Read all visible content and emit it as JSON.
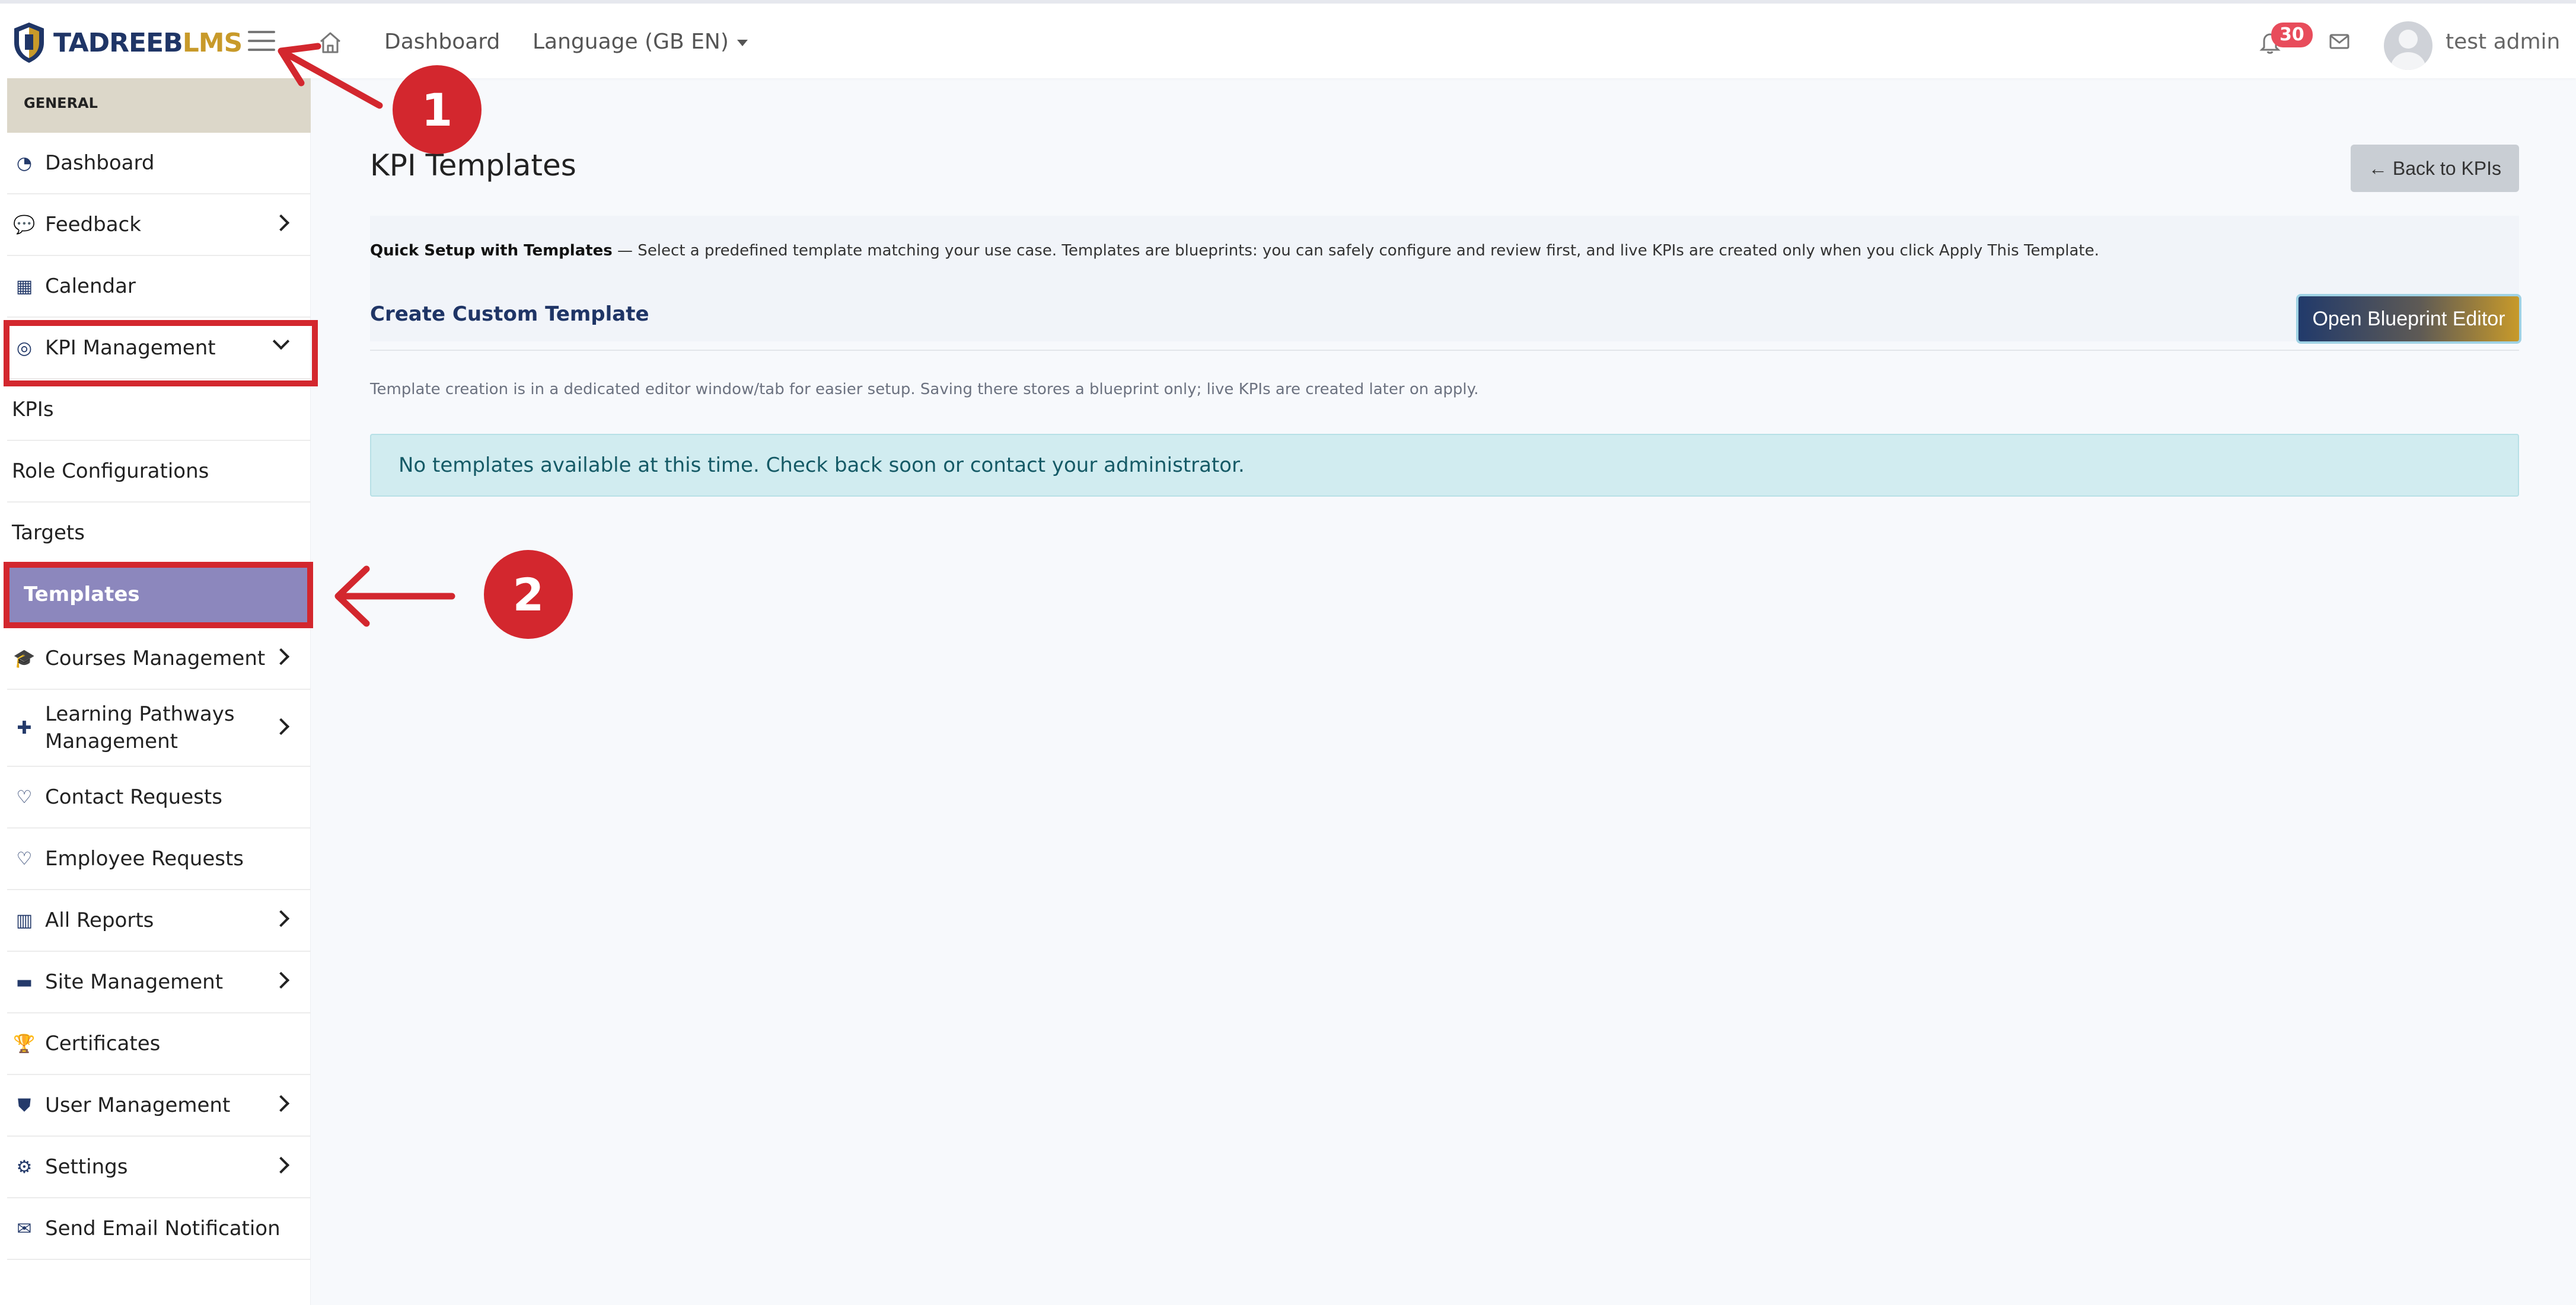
{
  "header": {
    "logo_text_a": "TADREEB",
    "logo_text_b": "LMS",
    "nav_dashboard": "Dashboard",
    "nav_language": "Language (GB EN)",
    "notification_count": "30",
    "username": "test admin"
  },
  "sidebar": {
    "section_label": "GENERAL",
    "items": {
      "dashboard": "Dashboard",
      "feedback": "Feedback",
      "calendar": "Calendar",
      "kpi_management": "KPI Management",
      "kpis": "KPIs",
      "role_configurations": "Role Configurations",
      "targets": "Targets",
      "templates": "Templates",
      "courses_management": "Courses Management",
      "learning_pathways_line1": "Learning Pathways",
      "learning_pathways_line2": "Management",
      "contact_requests": "Contact Requests",
      "employee_requests": "Employee Requests",
      "all_reports": "All Reports",
      "site_management": "Site Management",
      "certificates": "Certificates",
      "user_management": "User Management",
      "settings": "Settings",
      "send_email_notification": "Send Email Notification"
    }
  },
  "main": {
    "title": "KPI Templates",
    "back_button": "← Back to KPIs",
    "quick_setup_bold": "Quick Setup with Templates",
    "quick_setup_text": " — Select a predefined template matching your use case. Templates are blueprints: you can safely configure and review first, and live KPIs are created only when you click Apply This Template.",
    "custom_template_title": "Create Custom Template",
    "blueprint_button": "Open Blueprint Editor",
    "note": "Template creation is in a dedicated editor window/tab for easier setup. Saving there stores a blueprint only; live KPIs are created later on apply.",
    "alert": "No templates available at this time. Check back soon or contact your administrator."
  },
  "annotations": {
    "callout_1": "1",
    "callout_2": "2",
    "color": "#d3272e"
  },
  "colors": {
    "brand_navy": "#1f3566",
    "brand_gold": "#c89a2a",
    "active_item": "#8c87bd",
    "alert_bg": "#d1ecf0"
  }
}
